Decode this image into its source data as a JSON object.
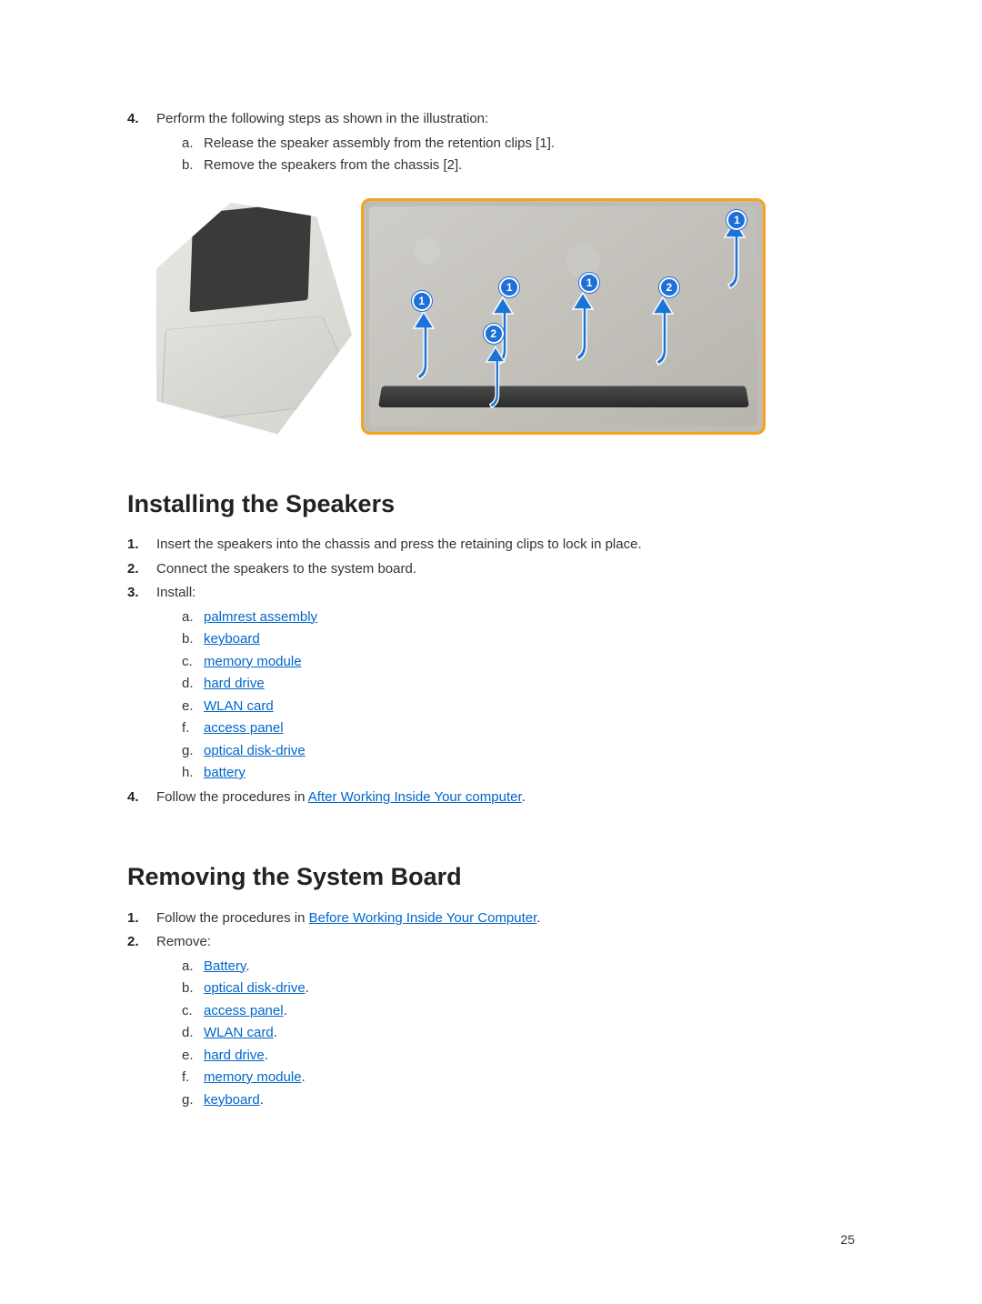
{
  "top": {
    "step4_num": "4.",
    "step4_text": "Perform the following steps as shown in the illustration:",
    "step4a_alpha": "a.",
    "step4a_text": "Release the speaker assembly from the retention clips [1].",
    "step4b_alpha": "b.",
    "step4b_text": "Remove the speakers from the chassis [2]."
  },
  "illustration": {
    "marker1": "1",
    "marker2": "2"
  },
  "install": {
    "heading": "Installing the Speakers",
    "s1_num": "1.",
    "s1_text": "Insert the speakers into the chassis and press the retaining clips to lock in place.",
    "s2_num": "2.",
    "s2_text": "Connect the speakers to the system board.",
    "s3_num": "3.",
    "s3_text": "Install:",
    "a_alpha": "a.",
    "a_link": "palmrest assembly",
    "b_alpha": "b.",
    "b_link": "keyboard",
    "c_alpha": "c.",
    "c_link": "memory module",
    "d_alpha": "d.",
    "d_link": "hard drive",
    "e_alpha": "e.",
    "e_link": "WLAN card",
    "f_alpha": "f.",
    "f_link": "access panel",
    "g_alpha": "g.",
    "g_link": "optical disk-drive",
    "h_alpha": "h.",
    "h_link": "battery",
    "s4_num": "4.",
    "s4_text_pre": "Follow the procedures in ",
    "s4_link": "After Working Inside Your computer",
    "s4_text_post": "."
  },
  "remove": {
    "heading": "Removing the System Board",
    "s1_num": "1.",
    "s1_text_pre": "Follow the procedures in ",
    "s1_link": "Before Working Inside Your Computer",
    "s1_text_post": ".",
    "s2_num": "2.",
    "s2_text": "Remove:",
    "a_alpha": "a.",
    "a_link": "Battery",
    "a_post": ".",
    "b_alpha": "b.",
    "b_link": "optical disk-drive",
    "b_post": ".",
    "c_alpha": "c.",
    "c_link": "access panel",
    "c_post": ".",
    "d_alpha": "d.",
    "d_link": "WLAN card",
    "d_post": ".",
    "e_alpha": "e.",
    "e_link": "hard drive",
    "e_post": ".",
    "f_alpha": "f.",
    "f_link": "memory module",
    "f_post": ".",
    "g_alpha": "g.",
    "g_link": "keyboard",
    "g_post": "."
  },
  "page_number": "25"
}
